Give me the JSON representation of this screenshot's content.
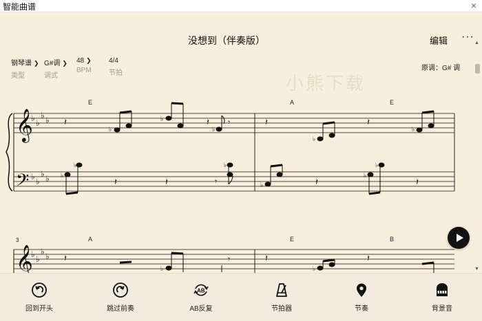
{
  "window": {
    "title": "智能曲谱",
    "close": "×"
  },
  "header": {
    "song_title": "没想到（伴奏版）",
    "edit_label": "编辑",
    "more_label": "···"
  },
  "settings": [
    {
      "value": "钢琴谱",
      "label": "类型",
      "has_chevron": true
    },
    {
      "value": "G#调",
      "label": "调式",
      "has_chevron": true
    },
    {
      "value": "48",
      "label": "BPM",
      "has_chevron": true
    },
    {
      "value": "4/4",
      "label": "节拍",
      "has_chevron": false
    }
  ],
  "original_key": "原调：G# 调",
  "watermark": "小熊下载",
  "score": {
    "chords_row1": [
      "E",
      "A",
      "E"
    ],
    "chords_row2": [
      "A",
      "E",
      "B"
    ],
    "measure_number_row2": "3"
  },
  "toolbar": [
    {
      "label": "回到开头",
      "icon": "restart-icon"
    },
    {
      "label": "跳过前奏",
      "icon": "skip-intro-icon"
    },
    {
      "label": "AB反复",
      "icon": "ab-repeat-icon"
    },
    {
      "label": "节拍器",
      "icon": "metronome-icon"
    },
    {
      "label": "节奏",
      "icon": "rhythm-icon"
    },
    {
      "label": "背景音",
      "icon": "piano-icon"
    }
  ],
  "colors": {
    "paper": "#f7efdc",
    "ink": "#111111",
    "toolbar_bg": "#f3ecde",
    "play_button": "#121212"
  }
}
